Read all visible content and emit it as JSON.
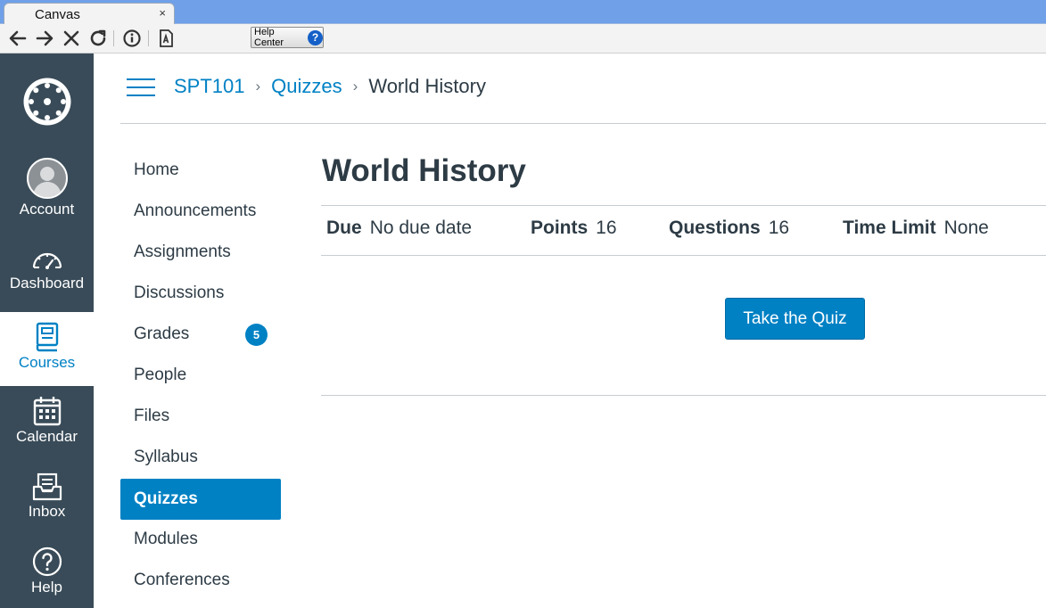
{
  "browser": {
    "tab_title": "Canvas",
    "tab_close": "×",
    "help_center_label": "Help Center",
    "help_center_icon": "?"
  },
  "global_nav": {
    "items": [
      {
        "label": "Account",
        "icon": "avatar-icon"
      },
      {
        "label": "Dashboard",
        "icon": "dashboard-icon"
      },
      {
        "label": "Courses",
        "icon": "courses-icon",
        "active": true
      },
      {
        "label": "Calendar",
        "icon": "calendar-icon"
      },
      {
        "label": "Inbox",
        "icon": "inbox-icon"
      },
      {
        "label": "Help",
        "icon": "help-icon"
      }
    ]
  },
  "breadcrumb": {
    "course": "SPT101",
    "section": "Quizzes",
    "current": "World History",
    "separator": "›"
  },
  "course_nav": {
    "items": [
      {
        "label": "Home"
      },
      {
        "label": "Announcements"
      },
      {
        "label": "Assignments"
      },
      {
        "label": "Discussions"
      },
      {
        "label": "Grades",
        "badge": "5"
      },
      {
        "label": "People"
      },
      {
        "label": "Files"
      },
      {
        "label": "Syllabus"
      },
      {
        "label": "Quizzes",
        "active": true
      },
      {
        "label": "Modules"
      },
      {
        "label": "Conferences"
      }
    ]
  },
  "quiz": {
    "title": "World History",
    "due_label": "Due",
    "due_value": "No due date",
    "points_label": "Points",
    "points_value": "16",
    "questions_label": "Questions",
    "questions_value": "16",
    "time_limit_label": "Time Limit",
    "time_limit_value": "None",
    "take_button": "Take the Quiz"
  },
  "colors": {
    "accent": "#0081c4",
    "nav_bg": "#394b58",
    "text": "#2d3b45"
  }
}
